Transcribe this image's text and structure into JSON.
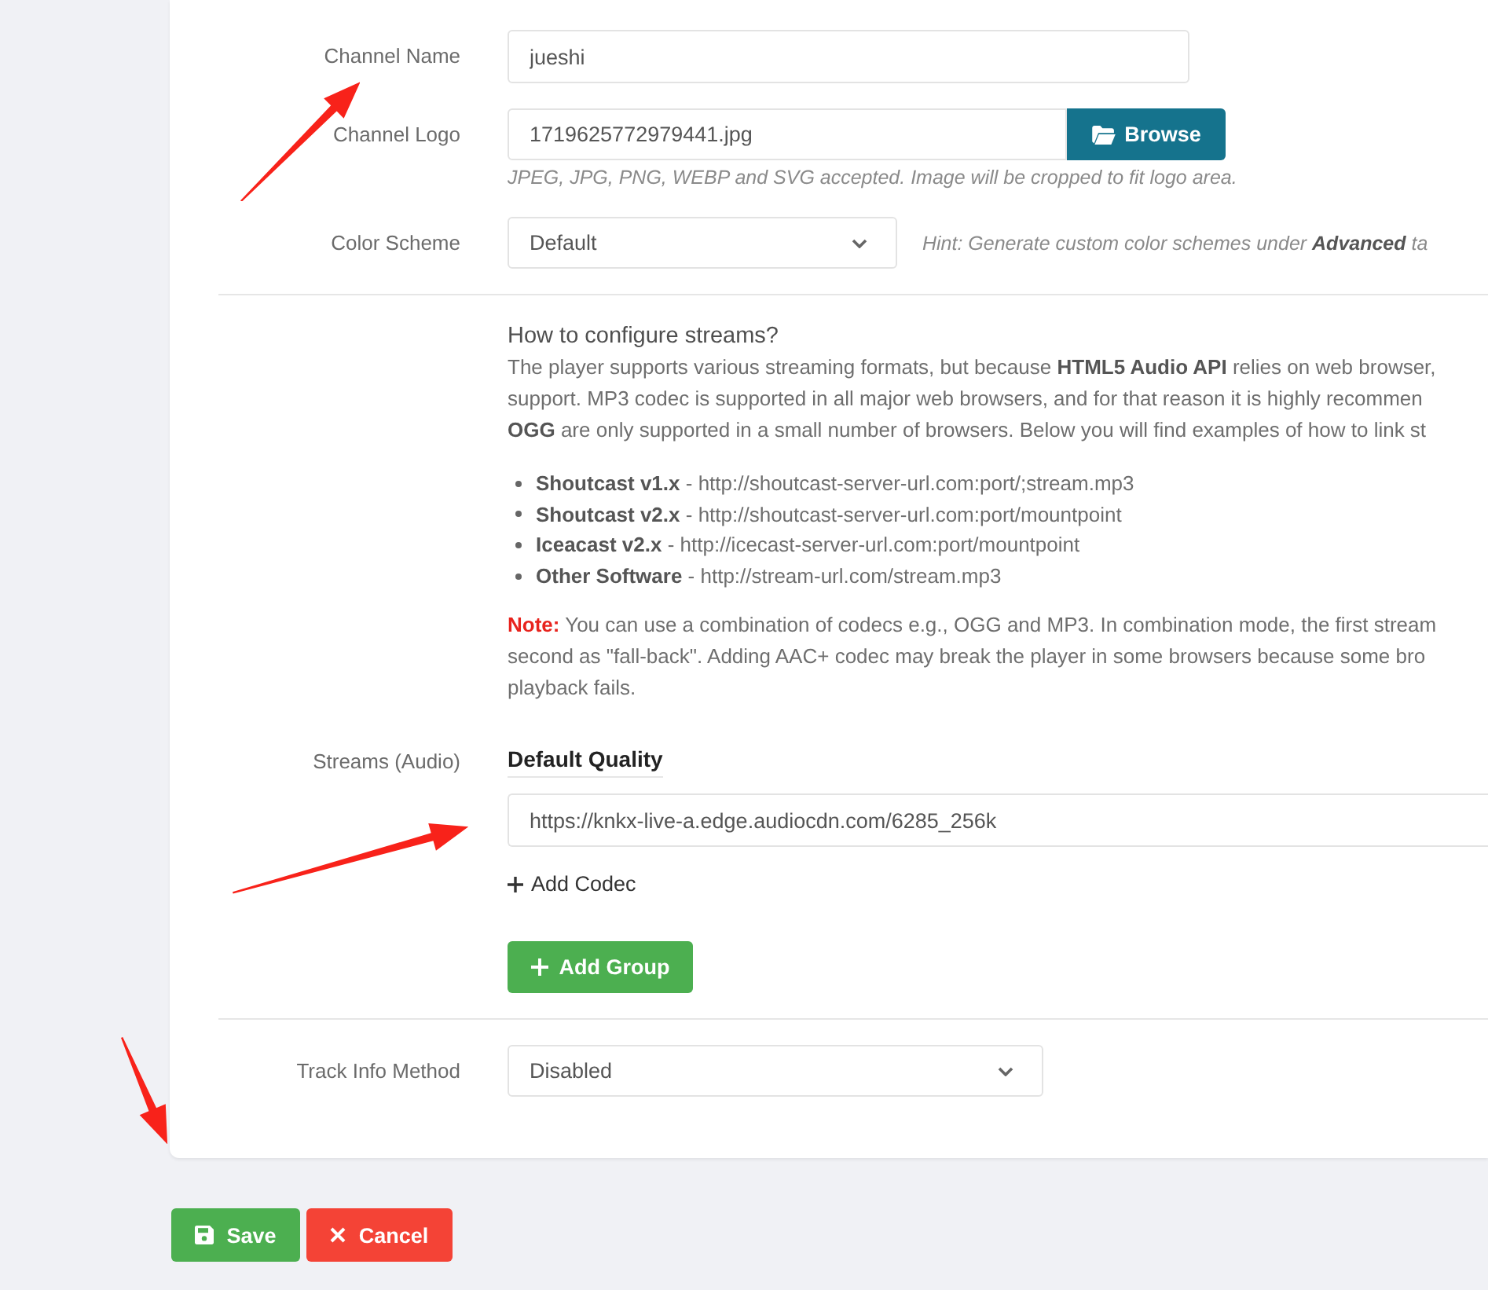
{
  "form": {
    "fields": [
      {
        "kind": "text",
        "label": "Channel Name",
        "value": "jueshi"
      },
      {
        "kind": "file",
        "label": "Channel Logo",
        "value": "1719625772979441.jpg",
        "button": "Browse",
        "help": "JPEG, JPG, PNG, WEBP and SVG accepted. Image will be cropped to fit logo area."
      },
      {
        "kind": "select",
        "label": "Color Scheme",
        "value": "Default",
        "hint": "Hint: Generate custom color schemes under **Advanced** ta"
      }
    ],
    "stream_help": {
      "title": "How to configure streams?",
      "lines": [
        "The player supports various streaming formats, but because **HTML5 Audio API** relies on web browser,",
        "support. MP3 codec is supported in all major web browsers, and for that reason it is highly recommen",
        "**OGG** are only supported in a small number of browsers. Below you will find examples of how to link st"
      ],
      "formats": [
        "**Shoutcast v1.x** - http://shoutcast-server-url.com:port/;stream.mp3",
        "**Shoutcast v2.x** - http://shoutcast-server-url.com:port/mountpoint",
        "**Iceacast v2.x** - http://icecast-server-url.com:port/mountpoint",
        "**Other Software** - http://stream-url.com/stream.mp3"
      ],
      "note": [
        "**Note:** You can use a combination of codecs e.g., OGG and MP3. In combination mode, the first stream",
        "second as \"fall-back\". Adding AAC+ codec may break the player in some browsers because some bro",
        "playback fails."
      ]
    },
    "streams": {
      "label": "Streams (Audio)",
      "group_title": "Default Quality",
      "url": "https://knkx-live-a.edge.audiocdn.com/6285_256k",
      "add_codec": "Add Codec",
      "add_group": "Add Group"
    },
    "track_info": {
      "kind": "select",
      "label": "Track Info Method",
      "value": "Disabled"
    }
  },
  "actions": [
    {
      "kind": "save",
      "label": "Save"
    },
    {
      "kind": "cancel",
      "label": "Cancel"
    }
  ]
}
